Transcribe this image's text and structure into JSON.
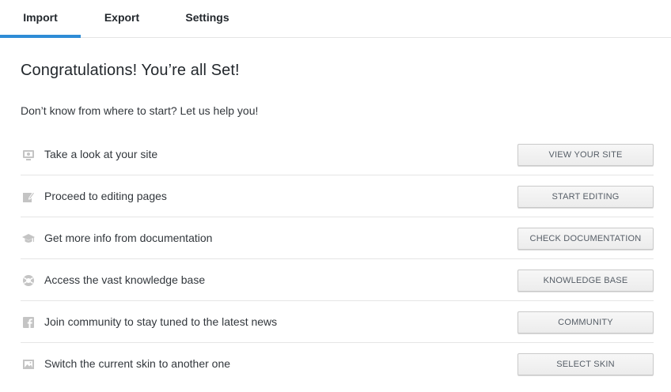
{
  "tabs": [
    {
      "label": "Import",
      "active": true
    },
    {
      "label": "Export",
      "active": false
    },
    {
      "label": "Settings",
      "active": false
    }
  ],
  "heading": "Congratulations! You’re all Set!",
  "subheading": "Don’t know from where to start? Let us help you!",
  "accent_color": "#2e8cd6",
  "rows": [
    {
      "icon": "monitor-icon",
      "label": "Take a look at your site",
      "button": "VIEW YOUR SITE"
    },
    {
      "icon": "edit-icon",
      "label": "Proceed to editing pages",
      "button": "START EDITING"
    },
    {
      "icon": "graduation-cap-icon",
      "label": "Get more info from documentation",
      "button": "CHECK DOCUMENTATION"
    },
    {
      "icon": "lifebuoy-icon",
      "label": "Access the vast knowledge base",
      "button": "KNOWLEDGE BASE"
    },
    {
      "icon": "facebook-icon",
      "label": "Join community to stay tuned to the latest news",
      "button": "COMMUNITY"
    },
    {
      "icon": "image-icon",
      "label": "Switch the current skin to another one",
      "button": "SELECT SKIN"
    }
  ]
}
